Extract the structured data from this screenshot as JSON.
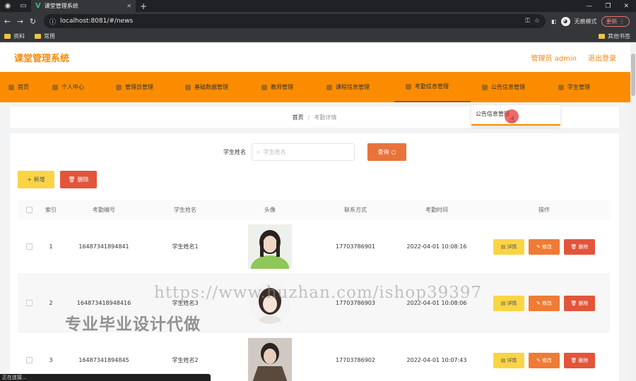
{
  "browser": {
    "tab_title": "课堂管理系统",
    "url": "localhost:8081/#/news",
    "window_controls": [
      "—",
      "❐",
      "✕"
    ],
    "profile_label": "无痕模式",
    "update_label": "更新",
    "bookmarks": [
      "资料",
      "常用"
    ],
    "bookmarks_other": "其他书签",
    "status_text": "正在连接..."
  },
  "header": {
    "title": "课堂管理系统",
    "user_label": "管理员 admin",
    "logout_label": "退出登录"
  },
  "menu": {
    "items": [
      {
        "label": "首页"
      },
      {
        "label": "个人中心"
      },
      {
        "label": "管理员管理"
      },
      {
        "label": "基础数据管理"
      },
      {
        "label": "教师管理"
      },
      {
        "label": "课程信息管理"
      },
      {
        "label": "考勤信息管理"
      },
      {
        "label": "公告信息管理"
      },
      {
        "label": "学生管理"
      }
    ],
    "dropdown_item": "公告信息管理"
  },
  "breadcrumb": {
    "home": "首页",
    "separator": "/",
    "current": "考勤详情"
  },
  "search": {
    "label": "学生姓名",
    "placeholder": "学生姓名",
    "button_label": "查询"
  },
  "actions": {
    "add_label": "+ 新增",
    "delete_label": "删除"
  },
  "table": {
    "headers": [
      "索引",
      "考勤编号",
      "学生姓名",
      "头像",
      "联系方式",
      "考勤时间",
      "操作"
    ],
    "row_buttons": {
      "detail": "详情",
      "edit": "修改",
      "delete": "删除"
    },
    "rows": [
      {
        "index": "1",
        "code": "16487341894841",
        "name": "学生姓名1",
        "phone": "17703786901",
        "time": "2022-04-01 10:08:16"
      },
      {
        "index": "2",
        "code": "164873418948416",
        "name": "学生姓名3",
        "phone": "17703786903",
        "time": "2022-04-01 10:08:06"
      },
      {
        "index": "3",
        "code": "16487341894845",
        "name": "学生姓名2",
        "phone": "17703786902",
        "time": "2022-04-01 10:07:43"
      }
    ]
  },
  "watermark": {
    "url": "https://www.huzhan.com/ishop39397",
    "text": "专业毕业设计代做"
  },
  "colors": {
    "accent": "#fb8c00",
    "title": "#f58a0c",
    "danger": "#e2553a",
    "warn": "#fbd446",
    "edit": "#ef7b35"
  }
}
